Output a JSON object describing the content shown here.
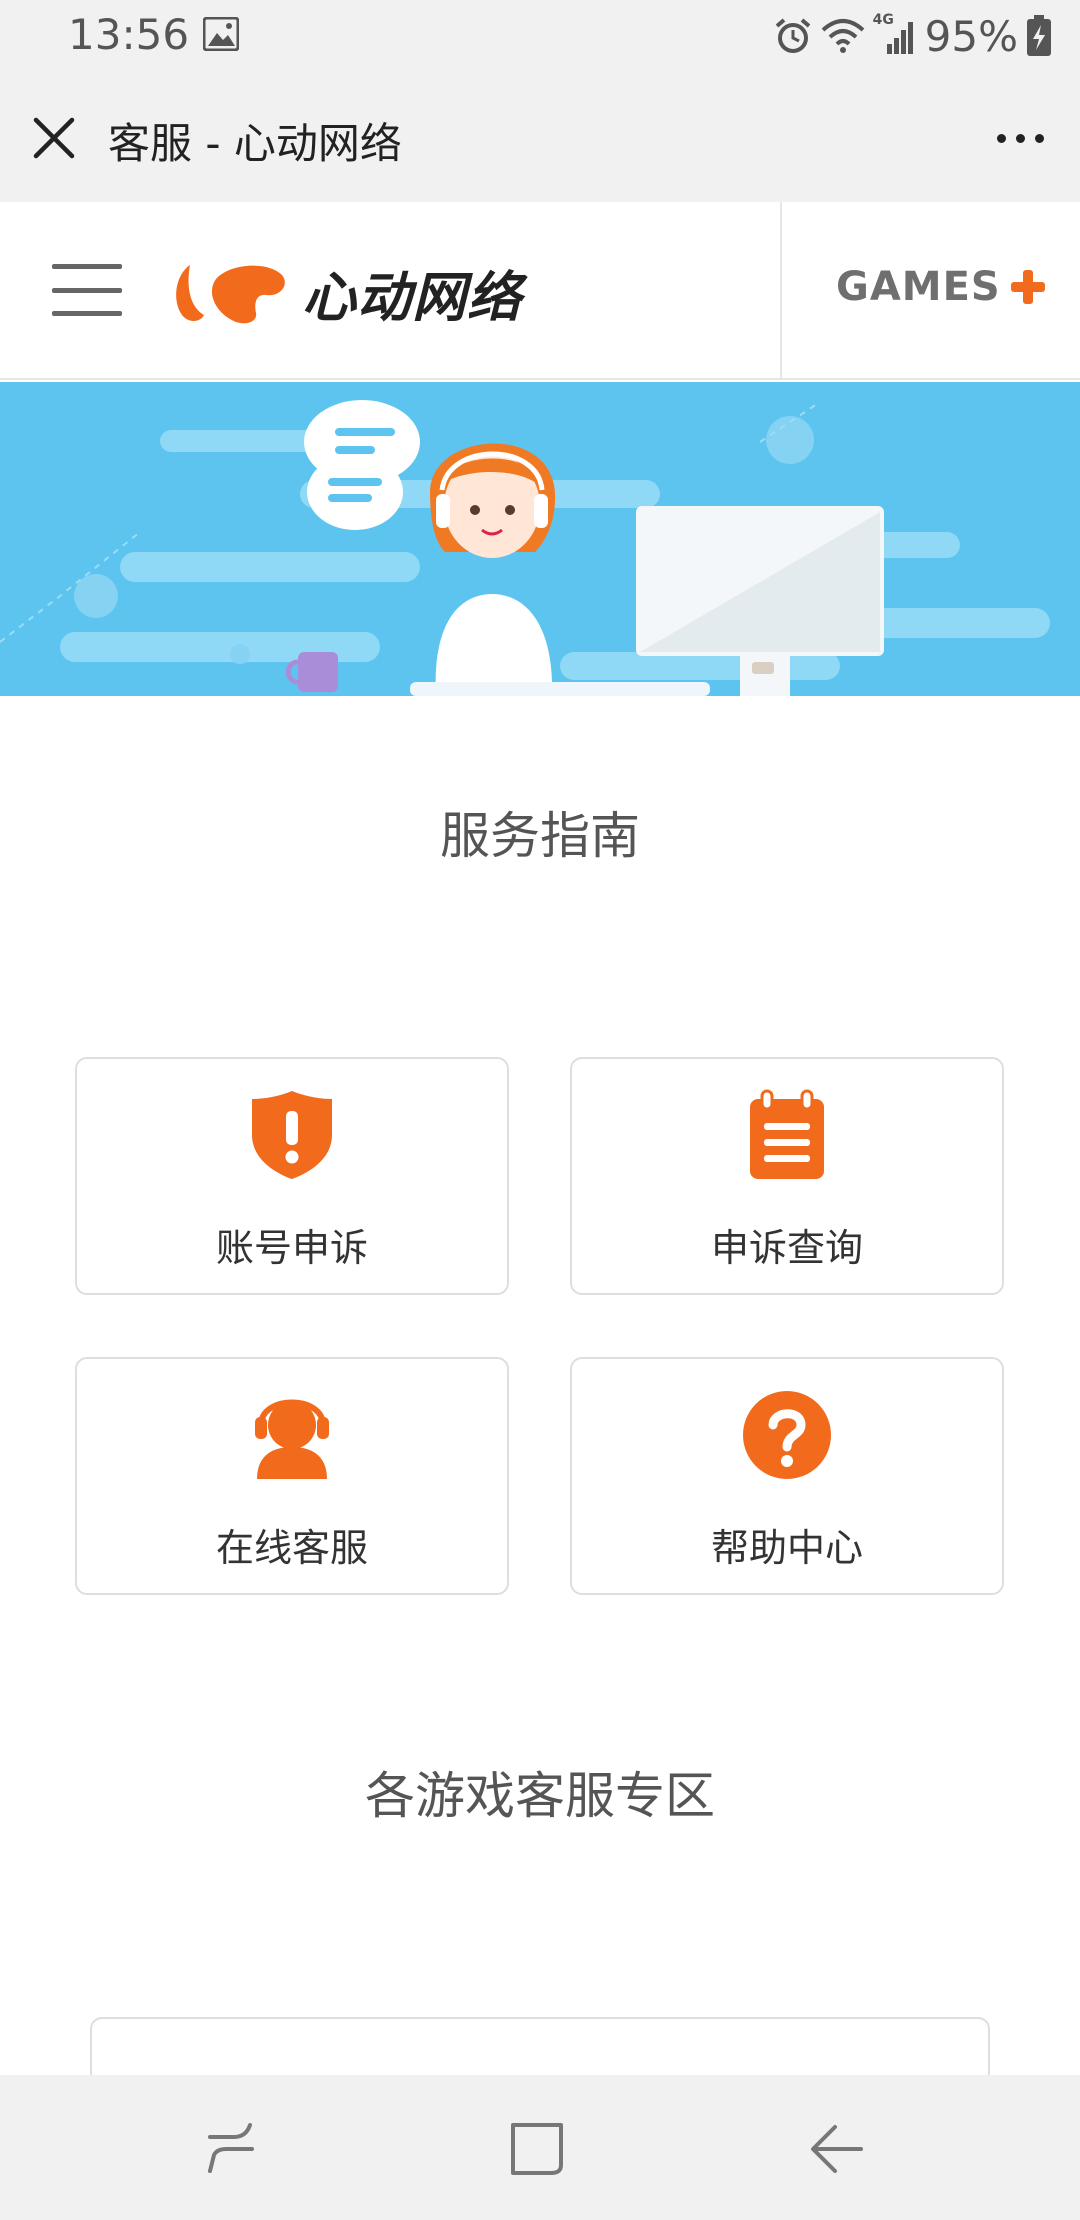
{
  "status_bar": {
    "time": "13:56",
    "network": "4G",
    "battery": "95%"
  },
  "title_bar": {
    "title": "客服 - 心动网络"
  },
  "header": {
    "logo_text": "心动网络",
    "games_label": "GAMES"
  },
  "services": {
    "section_title": "服务指南",
    "items": [
      {
        "label": "账号申诉",
        "icon": "shield-alert-icon"
      },
      {
        "label": "申诉查询",
        "icon": "notepad-icon"
      },
      {
        "label": "在线客服",
        "icon": "headset-agent-icon"
      },
      {
        "label": "帮助中心",
        "icon": "help-question-icon"
      }
    ]
  },
  "zones": {
    "section_title": "各游戏客服专区"
  },
  "colors": {
    "accent": "#f26b1d",
    "banner": "#5cc4ee",
    "bar_bg": "#f1f1f1"
  }
}
